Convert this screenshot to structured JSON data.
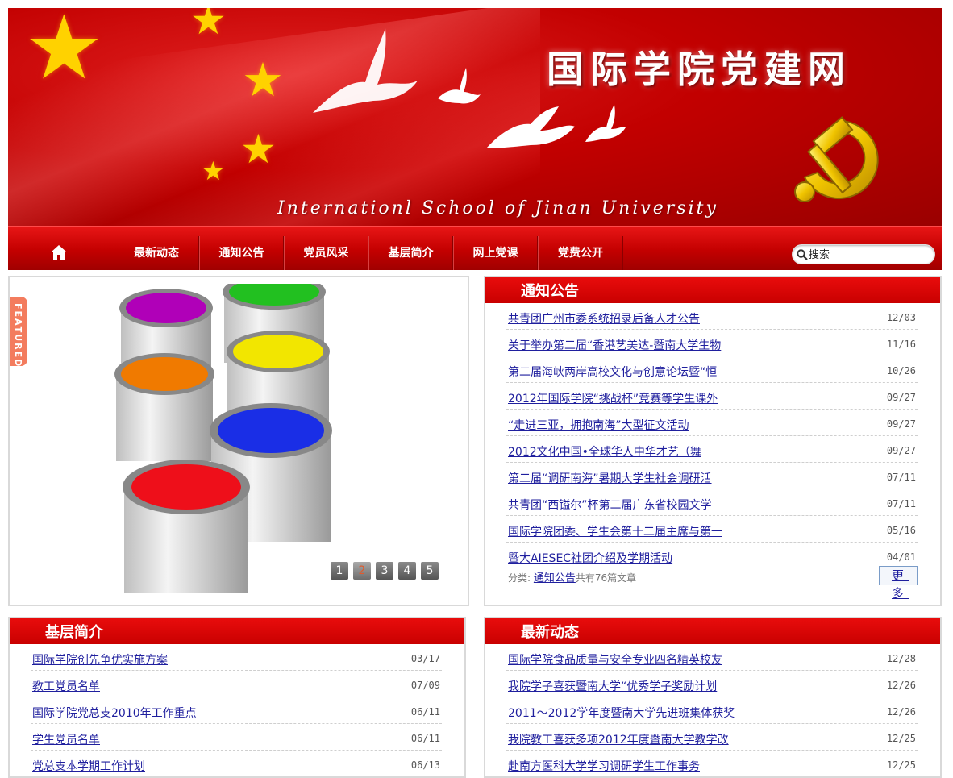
{
  "banner": {
    "title_cn": "国际学院党建网",
    "title_en": "Internationl School of Jinan University"
  },
  "nav": {
    "home_icon": "home-icon",
    "items": [
      "最新动态",
      "通知公告",
      "党员风采",
      "基层简介",
      "网上党课",
      "党费公开"
    ],
    "search_placeholder": "搜索"
  },
  "featured": {
    "tab_label": "FEATURED",
    "pager": [
      "1",
      "2",
      "3",
      "4",
      "5"
    ],
    "active_page": 2
  },
  "notices": {
    "title": "通知公告",
    "items": [
      {
        "text": "共青团广州市委系统招录后备人才公告",
        "date": "12/03"
      },
      {
        "text": "关于举办第二届“香港艺美达-暨南大学生物",
        "date": "11/16"
      },
      {
        "text": "第二届海峡两岸高校文化与创意论坛暨“恒",
        "date": "10/26"
      },
      {
        "text": "2012年国际学院“挑战杯”竞赛等学生课外",
        "date": "09/27"
      },
      {
        "text": "“走进三亚，拥抱南海”大型征文活动",
        "date": "09/27"
      },
      {
        "text": "2012文化中国•全球华人中华才艺（舞",
        "date": "09/27"
      },
      {
        "text": "第二届“调研南海”暑期大学生社会调研活",
        "date": "07/11"
      },
      {
        "text": "共青团“西镒尔”杯第二届广东省校园文学",
        "date": "07/11"
      },
      {
        "text": "国际学院团委、学生会第十二届主席与第一",
        "date": "05/16"
      },
      {
        "text": "暨大AIESEC社团介绍及学期活动",
        "date": "04/01"
      }
    ],
    "category_label": "分类:",
    "category_link": "通知公告",
    "count_text": "共有76篇文章",
    "more_label": "更多"
  },
  "grassroots": {
    "title": "基层简介",
    "items": [
      {
        "text": "国际学院创先争优实施方案",
        "date": "03/17"
      },
      {
        "text": "教工党员名单",
        "date": "07/09"
      },
      {
        "text": "国际学院党总支2010年工作重点",
        "date": "06/11"
      },
      {
        "text": "学生党员名单",
        "date": "06/11"
      },
      {
        "text": "党总支本学期工作计划",
        "date": "06/13"
      }
    ]
  },
  "latest": {
    "title": "最新动态",
    "items": [
      {
        "text": "国际学院食品质量与安全专业四名精英校友",
        "date": "12/28"
      },
      {
        "text": "我院学子喜获暨南大学“优秀学子奖励计划",
        "date": "12/26"
      },
      {
        "text": "2011～2012学年度暨南大学先进班集体获奖",
        "date": "12/26"
      },
      {
        "text": "我院教工喜获多项2012年度暨南大学教学改",
        "date": "12/25"
      },
      {
        "text": "赴南方医科大学学习调研学生工作事务",
        "date": "12/25"
      }
    ]
  },
  "colors": {
    "brand_red": "#c90000",
    "link_blue": "#1f1f9e",
    "featured_tab": "#f37c5e"
  }
}
